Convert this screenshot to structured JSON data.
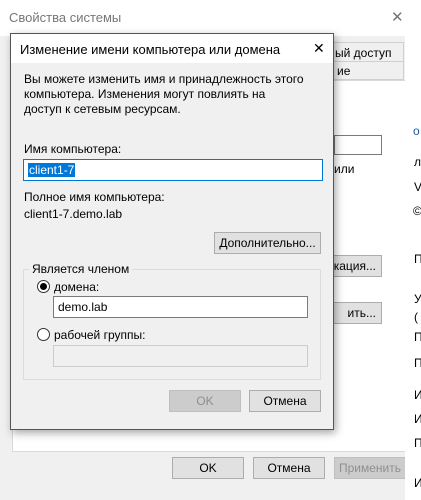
{
  "background_window": {
    "title": "Свойства системы",
    "close_glyph": "✕",
    "tab_fragment_1": "ый доступ",
    "tab_fragment_2": "ие",
    "frag_ili": "или",
    "frag_ikacia": "икация...",
    "frag_it": "ить...",
    "ok_label": "OK",
    "cancel_label": "Отмена",
    "apply_label": "Применить"
  },
  "side_fragments": [
    "о",
    "л",
    "V",
    "©",
    "П",
    "У",
    "(",
    "П",
    "П",
    "И",
    "И",
    "П",
    "И"
  ],
  "dialog": {
    "title": "Изменение имени компьютера или домена",
    "close_glyph": "✕",
    "description": "Вы можете изменить имя и принадлежность этого компьютера. Изменения могут повлиять на доступ к сетевым ресурсам.",
    "computer_name_label": "Имя компьютера:",
    "computer_name_value": "client1-7",
    "full_name_label": "Полное имя компьютера:",
    "full_name_value": "client1-7.demo.lab",
    "more_button": "Дополнительно...",
    "member_of_label": "Является членом",
    "domain_label": "домена:",
    "domain_value": "demo.lab",
    "workgroup_label": "рабочей группы:",
    "workgroup_value": "",
    "ok_label": "OK",
    "cancel_label": "Отмена",
    "selected_option": "domain"
  },
  "colors": {
    "accent": "#0078d7",
    "selection": "#0078d7",
    "window_bg": "#f0f0f0",
    "button_bg": "#e1e1e1"
  }
}
